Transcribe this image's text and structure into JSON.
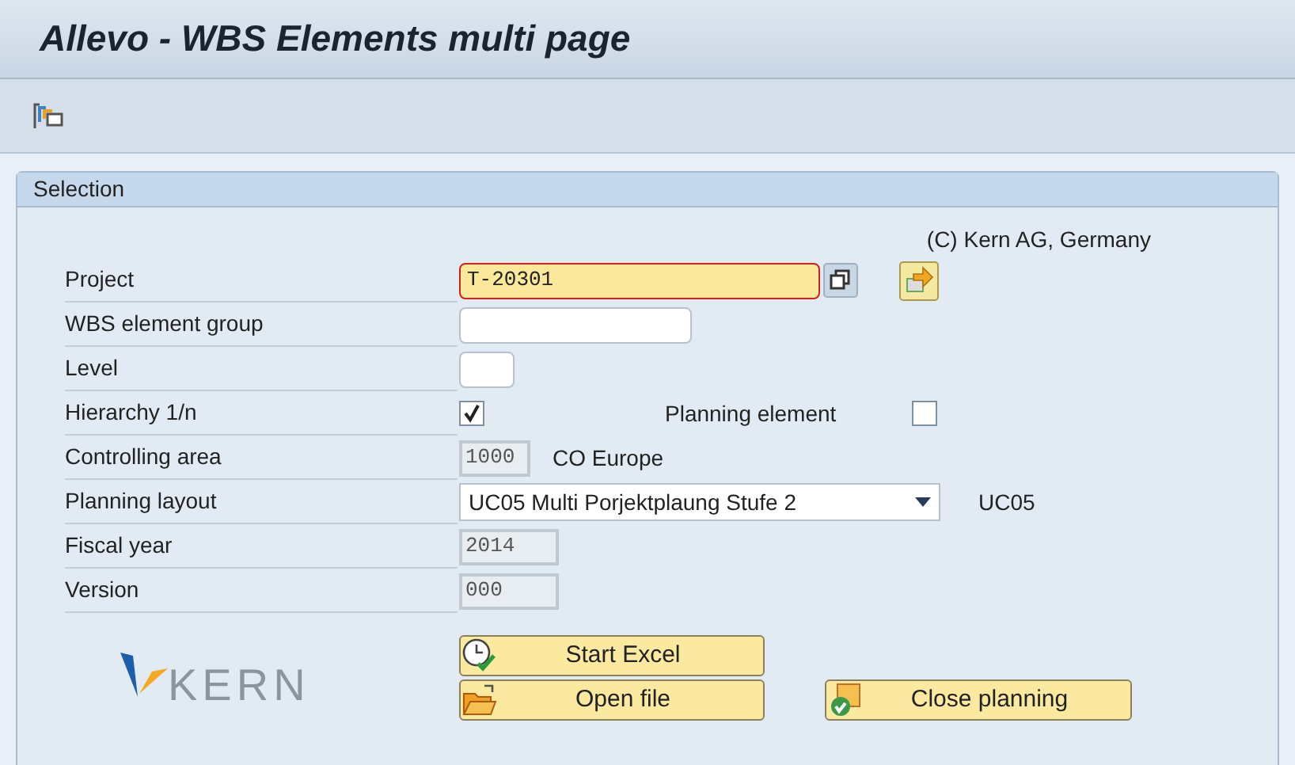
{
  "window": {
    "title": "Allevo - WBS Elements multi page"
  },
  "group": {
    "title": "Selection",
    "copyright": "(C) Kern AG, Germany"
  },
  "rows": [
    {
      "label": "Project",
      "kind": "input",
      "value": "T-20301",
      "focused": true
    },
    {
      "label": "WBS element group",
      "kind": "input",
      "value": "",
      "focused": false
    },
    {
      "label": "Level",
      "kind": "input",
      "value": "",
      "focused": false
    },
    {
      "label": "Hierarchy 1/n",
      "kind": "checkbox",
      "checked": true,
      "side_label": "Planning element",
      "side_checked": false
    },
    {
      "label": "Controlling area",
      "kind": "display",
      "value": "1000",
      "description": "CO Europe"
    },
    {
      "label": "Planning layout",
      "kind": "dropdown",
      "value": "UC05 Multi Porjektplaung Stufe 2",
      "description": "UC05"
    },
    {
      "label": "Fiscal year",
      "kind": "display",
      "value": "2014"
    },
    {
      "label": "Version",
      "kind": "display",
      "value": "000"
    }
  ],
  "logo": {
    "text": "KERN"
  },
  "buttons": [
    {
      "label": "Start Excel",
      "kind": "excel"
    },
    {
      "label": "Open file",
      "kind": "open"
    },
    {
      "label": "Close planning",
      "kind": "close"
    }
  ]
}
